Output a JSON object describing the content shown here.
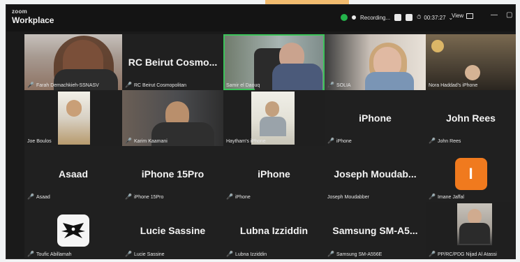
{
  "app": {
    "brand_top": "zoom",
    "brand_bottom": "Workplace",
    "recording_label": "Recording...",
    "timer": "00:37:27",
    "view_label": "View"
  },
  "colors": {
    "active_speaker": "#3cc35a",
    "mic_muted": "#d23535",
    "orange_avatar": "#f07a1e"
  },
  "tiles": [
    {
      "name": "Farah Demachkieh-SSNASV",
      "title": "",
      "kind": "video"
    },
    {
      "name": "RC Beirut Cosmopolitan",
      "title": "RC Beirut Cosmo...",
      "kind": "text"
    },
    {
      "name": "Samir el Daouq",
      "title": "",
      "kind": "video"
    },
    {
      "name": "SOLIA",
      "title": "",
      "kind": "video"
    },
    {
      "name": "Nora Haddad's iPhone",
      "title": "",
      "kind": "video"
    },
    {
      "name": "Joe Boulos",
      "title": "",
      "kind": "video"
    },
    {
      "name": "Karim Kaamani",
      "title": "",
      "kind": "video"
    },
    {
      "name": "Haytham's iPhone",
      "title": "",
      "kind": "video"
    },
    {
      "name": "iPhone",
      "title": "iPhone",
      "kind": "text"
    },
    {
      "name": "John Rees",
      "title": "John Rees",
      "kind": "text"
    },
    {
      "name": "Asaad",
      "title": "Asaad",
      "kind": "text"
    },
    {
      "name": "iPhone 15Pro",
      "title": "iPhone 15Pro",
      "kind": "text"
    },
    {
      "name": "iPhone",
      "title": "iPhone",
      "kind": "text"
    },
    {
      "name": "Joseph Moudabber",
      "title": "Joseph Moudab...",
      "kind": "text"
    },
    {
      "name": "Imane Jaffal",
      "title": "",
      "kind": "avatar",
      "avatar_text": "I"
    },
    {
      "name": "Toufic Abillamah",
      "title": "",
      "kind": "logo"
    },
    {
      "name": "Lucie Sassine",
      "title": "Lucie Sassine",
      "kind": "text"
    },
    {
      "name": "Lubna Izziddin",
      "title": "Lubna Izziddin",
      "kind": "text"
    },
    {
      "name": "Samsung SM-A556E",
      "title": "Samsung SM-A5...",
      "kind": "text"
    },
    {
      "name": "PP/RC/PDG Nijad Al Atassi",
      "title": "",
      "kind": "video"
    }
  ]
}
